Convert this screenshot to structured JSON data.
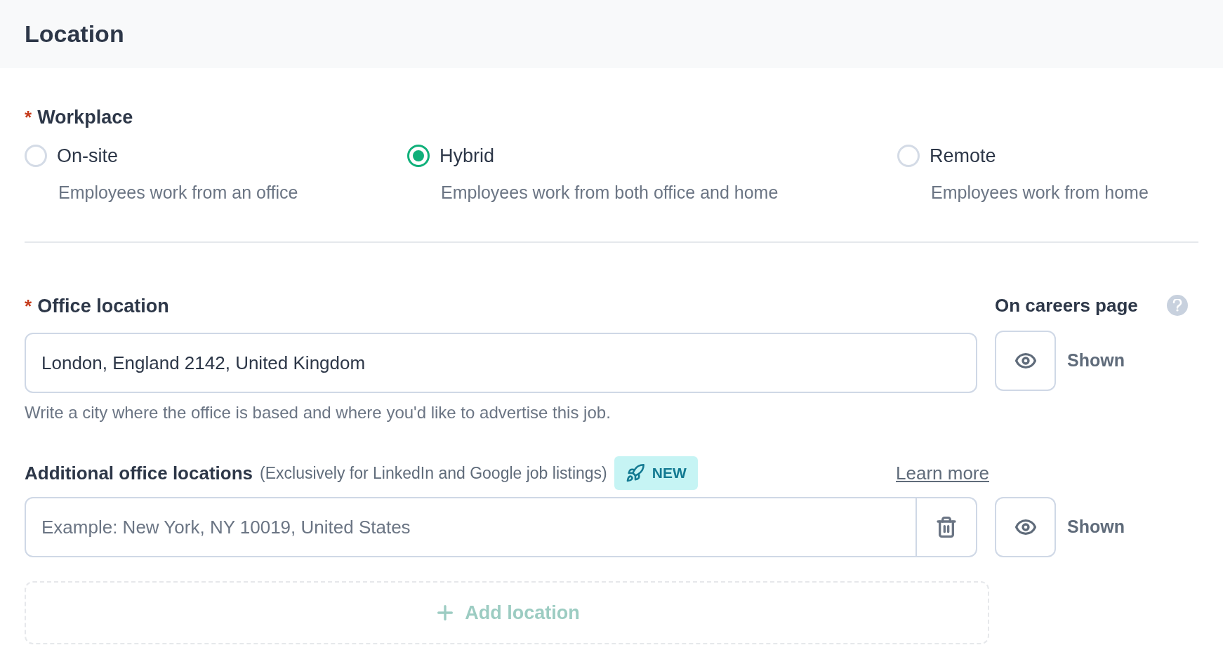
{
  "header": {
    "title": "Location"
  },
  "workplace": {
    "label": "Workplace",
    "required_mark": "*",
    "options": [
      {
        "label": "On-site",
        "description": "Employees work from an office",
        "selected": false
      },
      {
        "label": "Hybrid",
        "description": "Employees work from both office and home",
        "selected": true
      },
      {
        "label": "Remote",
        "description": "Employees work from home",
        "selected": false
      }
    ]
  },
  "office_location": {
    "label": "Office location",
    "required_mark": "*",
    "value": "London, England 2142, United Kingdom",
    "hint": "Write a city where the office is based and where you'd like to advertise this job.",
    "careers_label": "On careers page",
    "visibility": "Shown"
  },
  "additional_locations": {
    "label": "Additional office locations",
    "note": "(Exclusively for LinkedIn and Google job listings)",
    "badge": "NEW",
    "link": "Learn more",
    "placeholder": "Example: New York, NY 10019, United States",
    "visibility": "Shown",
    "add_button": "Add location"
  }
}
